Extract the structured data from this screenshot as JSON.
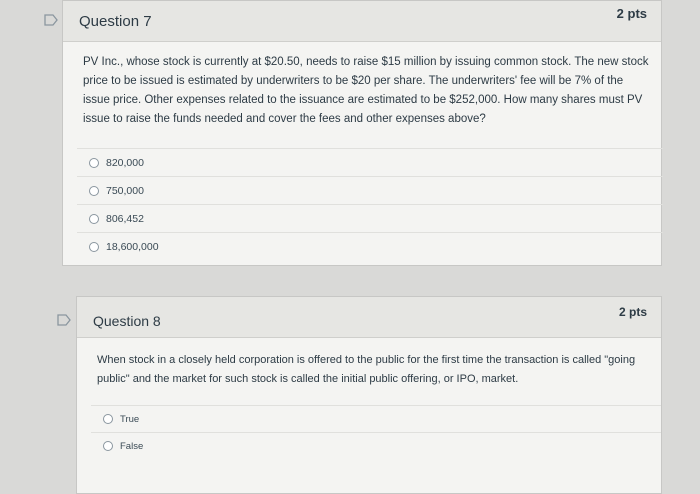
{
  "q7": {
    "title": "Question 7",
    "points": "2 pts",
    "text": "PV Inc., whose stock is currently at $20.50, needs to raise $15 million by issuing common stock. The new stock price to be issued is estimated by underwriters to be $20 per share. The underwriters' fee will be 7% of the issue price. Other expenses related to the issuance are estimated to be $252,000. How many shares must PV issue to raise the funds needed and cover the fees and other expenses above?",
    "options": [
      "820,000",
      "750,000",
      "806,452",
      "18,600,000"
    ]
  },
  "q8": {
    "title": "Question 8",
    "points": "2 pts",
    "text": "When stock in a closely held corporation is offered to the public for the first time the transaction is called \"going public\" and the market for such stock is called the initial public offering, or IPO, market.",
    "options": [
      "True",
      "False"
    ]
  },
  "colors": {
    "flag": "#8a969f",
    "card_bg": "#f4f4f2",
    "header_bg": "#e6e6e3"
  }
}
